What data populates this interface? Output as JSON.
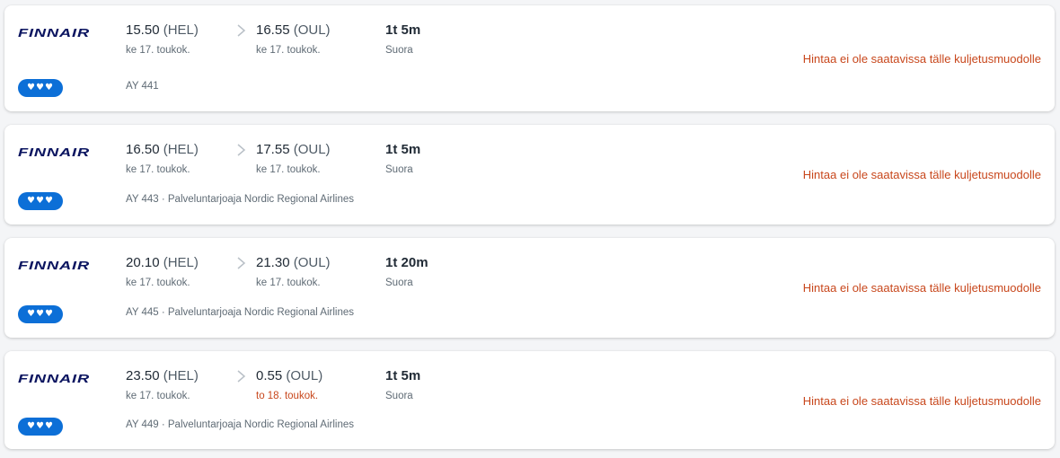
{
  "flights": [
    {
      "airline": "FINNAIR",
      "hearts": "♥♥♥",
      "dep_time": "15.50",
      "dep_code": "(HEL)",
      "dep_date": "ke 17. toukok.",
      "arr_time": "16.55",
      "arr_code": "(OUL)",
      "arr_date": "ke 17. toukok.",
      "duration": "1t 5m",
      "stops": "Suora",
      "flight_info": "AY 441",
      "price_msg": "Hintaa ei ole saatavissa tälle kuljetusmuodolle"
    },
    {
      "airline": "FINNAIR",
      "hearts": "♥♥♥",
      "dep_time": "16.50",
      "dep_code": "(HEL)",
      "dep_date": "ke 17. toukok.",
      "arr_time": "17.55",
      "arr_code": "(OUL)",
      "arr_date": "ke 17. toukok.",
      "duration": "1t 5m",
      "stops": "Suora",
      "flight_info": "AY 443 · Palveluntarjoaja Nordic Regional Airlines",
      "price_msg": "Hintaa ei ole saatavissa tälle kuljetusmuodolle"
    },
    {
      "airline": "FINNAIR",
      "hearts": "♥♥♥",
      "dep_time": "20.10",
      "dep_code": "(HEL)",
      "dep_date": "ke 17. toukok.",
      "arr_time": "21.30",
      "arr_code": "(OUL)",
      "arr_date": "ke 17. toukok.",
      "duration": "1t 20m",
      "stops": "Suora",
      "flight_info": "AY 445 · Palveluntarjoaja Nordic Regional Airlines",
      "price_msg": "Hintaa ei ole saatavissa tälle kuljetusmuodolle"
    },
    {
      "airline": "FINNAIR",
      "hearts": "♥♥♥",
      "dep_time": "23.50",
      "dep_code": "(HEL)",
      "dep_date": "ke 17. toukok.",
      "arr_time": "0.55",
      "arr_code": "(OUL)",
      "arr_date": "to 18. toukok.",
      "duration": "1t 5m",
      "stops": "Suora",
      "flight_info": "AY 449 · Palveluntarjoaja Nordic Regional Airlines",
      "price_msg": "Hintaa ei ole saatavissa tälle kuljetusmuodolle"
    }
  ],
  "colors": {
    "brand_navy": "#0b1560",
    "hearts_blue": "#0c6fd7",
    "warning_orange": "#c8471c",
    "text_dark": "#212b36",
    "text_muted": "#5f6b75"
  },
  "icons": {
    "airline_logo": "finnair-logo-icon",
    "route_separator": "chevron-right-icon",
    "rating": "hearts-icon"
  }
}
